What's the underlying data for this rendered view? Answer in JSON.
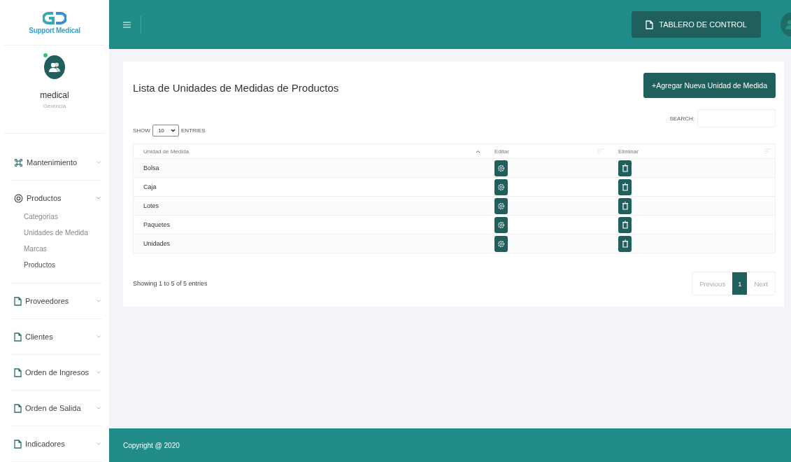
{
  "brand": {
    "name": "Support Medical"
  },
  "user": {
    "name": "medical",
    "role": "Gerencia",
    "online": true
  },
  "sidebar": {
    "items": [
      {
        "label": "Mantenimiento",
        "kind": "command",
        "expanded": false
      },
      {
        "label": "Productos",
        "kind": "eye",
        "expanded": true,
        "children": [
          {
            "label": "Categorías",
            "selected": false
          },
          {
            "label": "Unidades de Medida",
            "selected": false
          },
          {
            "label": "Marcas",
            "selected": false
          },
          {
            "label": "Productos",
            "selected": true
          }
        ]
      },
      {
        "label": "Proveedores",
        "kind": "file",
        "expanded": false
      },
      {
        "label": "Clientes",
        "kind": "file",
        "expanded": false
      },
      {
        "label": "Orden de Ingresos",
        "kind": "file",
        "expanded": false
      },
      {
        "label": "Orden de Salida",
        "kind": "file",
        "expanded": false
      },
      {
        "label": "Indicadores",
        "kind": "file",
        "expanded": false
      }
    ]
  },
  "header": {
    "button": "TABLERO DE CONTROL"
  },
  "card": {
    "title": "Lista de Unidades de Medidas de Productos",
    "add_button": "+Agregar Nueva Unidad de Medida",
    "length": {
      "before": "SHOW",
      "value": "10",
      "after": "ENTRIES"
    },
    "search": {
      "label": "SEARCH:"
    },
    "columns": [
      {
        "label": "Unidad de Medida",
        "sorted": true
      },
      {
        "label": "Editar",
        "sorted": false
      },
      {
        "label": "Eliminar",
        "sorted": false
      }
    ],
    "rows": [
      {
        "name": "Bolsa"
      },
      {
        "name": "Caja"
      },
      {
        "name": "Lotes"
      },
      {
        "name": "Paquetes"
      },
      {
        "name": "Unidades"
      }
    ],
    "info": "Showing 1 to 5 of 5 entries",
    "pagination": [
      {
        "label": "Previous",
        "disabled": true,
        "selected": false
      },
      {
        "label": "1",
        "disabled": false,
        "selected": true
      },
      {
        "label": "Next",
        "disabled": true,
        "selected": false
      }
    ]
  },
  "footer": {
    "text": "Copyright @ 2020"
  }
}
